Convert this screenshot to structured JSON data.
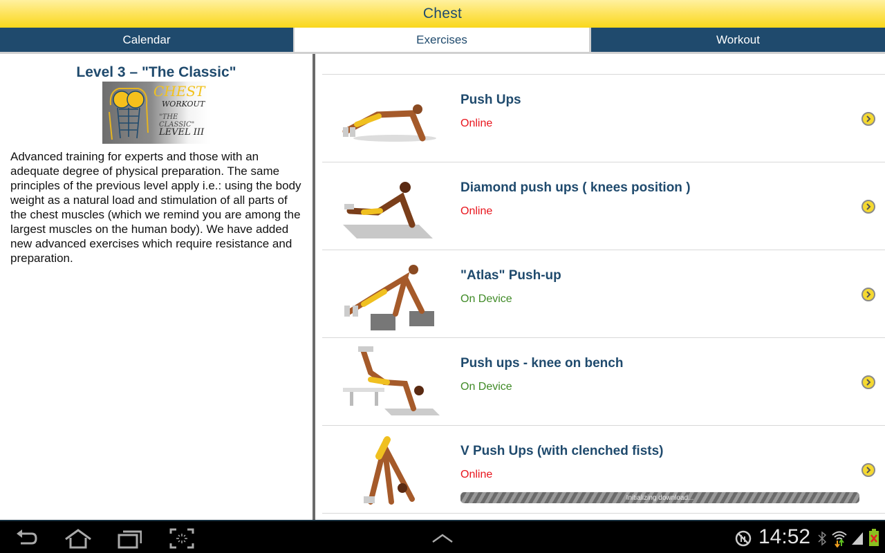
{
  "app": {
    "title": "Chest"
  },
  "tabs": [
    {
      "label": "Calendar",
      "active": false
    },
    {
      "label": "Exercises",
      "active": true
    },
    {
      "label": "Workout",
      "active": false
    }
  ],
  "level": {
    "title": "Level 3 – \"The Classic\"",
    "image_lines": [
      "CHEST",
      "WORKOUT",
      "\"THE CLASSIC\"",
      "LEVEL III"
    ],
    "description": "Advanced training for experts and those with an adequate degree of physical preparation. The same principles of the previous level apply i.e.: using the body weight as a natural load and stimulation of all parts of the chest muscles (which we remind you are among the largest muscles on the human body). We have added new advanced exercises which require resistance and preparation."
  },
  "status_colors": {
    "online": "#e8141c",
    "on_device": "#3f8a26"
  },
  "exercises": [
    {
      "name": "Push Ups",
      "status": "Online",
      "status_type": "online",
      "icon": "chevron-right-circle-icon"
    },
    {
      "name": "Diamond push ups ( knees position )",
      "status": "Online",
      "status_type": "online",
      "icon": "chevron-right-circle-icon"
    },
    {
      "name": "\"Atlas\" Push-up",
      "status": "On Device",
      "status_type": "on_device",
      "icon": "chevron-right-circle-icon"
    },
    {
      "name": "Push ups - knee on bench",
      "status": "On Device",
      "status_type": "on_device",
      "icon": "chevron-right-circle-icon"
    },
    {
      "name": "V Push Ups (with clenched fists)",
      "status": "Online",
      "status_type": "online",
      "icon": "chevron-right-circle-icon",
      "download": {
        "label": "Initializing download...",
        "progress": null
      }
    }
  ],
  "system_bar": {
    "nav_icons": [
      "back-icon",
      "home-icon",
      "recent-apps-icon",
      "screenshot-icon",
      "up-caret-icon"
    ],
    "time": "14:52",
    "status_icons": [
      "no-sync-icon",
      "bluetooth-icon",
      "wifi-icon",
      "signal-icon",
      "battery-icon"
    ]
  }
}
